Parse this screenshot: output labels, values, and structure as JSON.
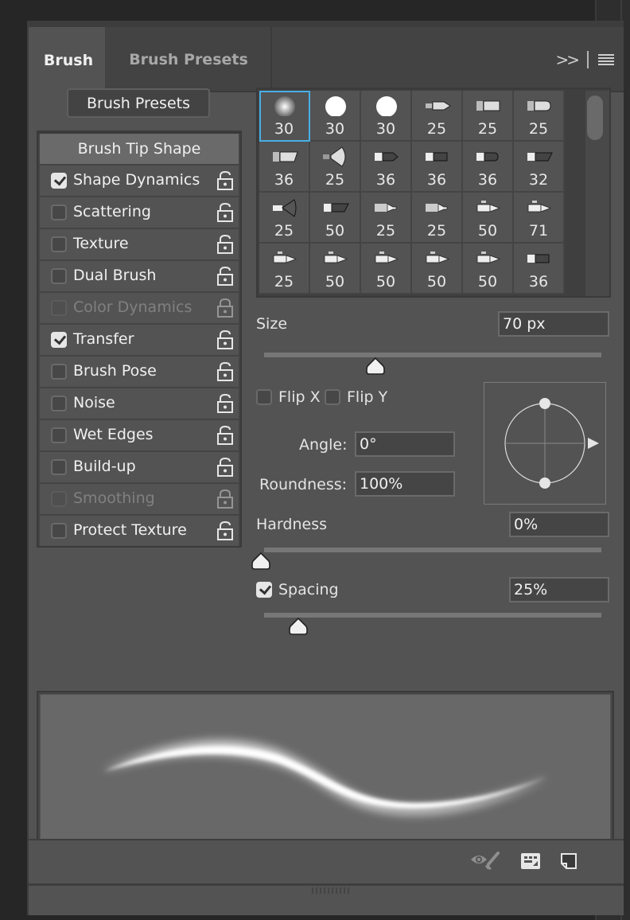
{
  "tabs": [
    {
      "label": "Brush",
      "active": true
    },
    {
      "label": "Brush Presets",
      "active": false
    }
  ],
  "tab_icons": {
    "expand": "double-chevron-right-icon",
    "menu": "hamburger-menu-icon"
  },
  "presets_button": "Brush Presets",
  "options": [
    {
      "label": "Brush Tip Shape",
      "header": true
    },
    {
      "label": "Shape Dynamics",
      "checked": true,
      "disabled": false
    },
    {
      "label": "Scattering",
      "checked": false,
      "disabled": false
    },
    {
      "label": "Texture",
      "checked": false,
      "disabled": false
    },
    {
      "label": "Dual Brush",
      "checked": false,
      "disabled": false
    },
    {
      "label": "Color Dynamics",
      "checked": false,
      "disabled": true
    },
    {
      "label": "Transfer",
      "checked": true,
      "disabled": false
    },
    {
      "label": "Brush Pose",
      "checked": false,
      "disabled": false
    },
    {
      "label": "Noise",
      "checked": false,
      "disabled": false
    },
    {
      "label": "Wet Edges",
      "checked": false,
      "disabled": false
    },
    {
      "label": "Build-up",
      "checked": false,
      "disabled": false
    },
    {
      "label": "Smoothing",
      "checked": false,
      "disabled": true
    },
    {
      "label": "Protect Texture",
      "checked": false,
      "disabled": false
    }
  ],
  "brush_tips": [
    {
      "size": "30",
      "type": "soft-round",
      "selected": true
    },
    {
      "size": "30",
      "type": "hard-round"
    },
    {
      "size": "30",
      "type": "hard-round"
    },
    {
      "size": "25",
      "type": "pointed-brush"
    },
    {
      "size": "25",
      "type": "flat-brush"
    },
    {
      "size": "25",
      "type": "round-flat-brush"
    },
    {
      "size": "36",
      "type": "angled-brush"
    },
    {
      "size": "25",
      "type": "fan-brush"
    },
    {
      "size": "36",
      "type": "pointed-dark-brush"
    },
    {
      "size": "36",
      "type": "flat-dark-brush"
    },
    {
      "size": "36",
      "type": "round-dark-brush"
    },
    {
      "size": "32",
      "type": "angled-dark-brush"
    },
    {
      "size": "25",
      "type": "airbrush"
    },
    {
      "size": "50",
      "type": "angled-dark-brush"
    },
    {
      "size": "25",
      "type": "marker"
    },
    {
      "size": "25",
      "type": "marker"
    },
    {
      "size": "50",
      "type": "pencil"
    },
    {
      "size": "71",
      "type": "pencil"
    },
    {
      "size": "25",
      "type": "pencil"
    },
    {
      "size": "50",
      "type": "pencil"
    },
    {
      "size": "50",
      "type": "pencil"
    },
    {
      "size": "50",
      "type": "pencil"
    },
    {
      "size": "50",
      "type": "pencil"
    },
    {
      "size": "36",
      "type": "flat-dark-brush"
    }
  ],
  "size": {
    "label": "Size",
    "value": "70 px",
    "slider_fraction": 0.34
  },
  "flip_x": {
    "label": "Flip X",
    "checked": false
  },
  "flip_y": {
    "label": "Flip Y",
    "checked": false
  },
  "angle": {
    "label": "Angle:",
    "value": "0°"
  },
  "roundness": {
    "label": "Roundness:",
    "value": "100%"
  },
  "hardness": {
    "label": "Hardness",
    "value": "0%",
    "slider_fraction": 0.0
  },
  "spacing": {
    "label": "Spacing",
    "value": "25%",
    "checked": true,
    "slider_fraction": 0.11
  },
  "bottom_icons": [
    "toggle-live-tip-preview-icon",
    "brush-projection-icon",
    "new-brush-icon"
  ]
}
